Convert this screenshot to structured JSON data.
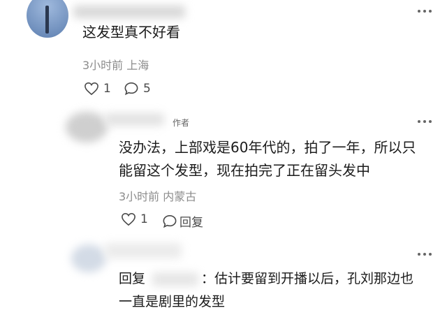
{
  "comments": [
    {
      "text": "这发型真不好看",
      "meta": "3小时前 上海",
      "likes": "1",
      "replies": "5"
    }
  ],
  "reply1": {
    "badge": "作者",
    "lines": [
      "没办法，上部戏是60年代的，拍了一年，所以只",
      "能留这个发型，现在拍完了正在留头发中"
    ],
    "meta": "3小时前 内蒙古",
    "likes": "1",
    "reply_label": "回复"
  },
  "reply2": {
    "prefix": "回复",
    "rest": "：估计要留到开播以后，孔刘那边也",
    "line2": "一直是剧里的发型"
  }
}
